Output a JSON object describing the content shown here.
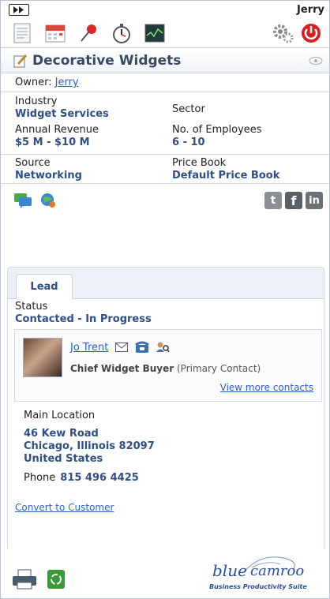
{
  "topbar": {
    "user": "Jerry"
  },
  "toolbar": {
    "icons": [
      "notes-icon",
      "calendar-icon",
      "pin-icon",
      "stopwatch-icon",
      "dashboard-icon",
      "settings-icon",
      "power-icon"
    ]
  },
  "record": {
    "title": "Decorative Widgets",
    "owner_label": "Owner:",
    "owner": "Jerry"
  },
  "fields": {
    "industry_label": "Industry",
    "industry": "Widget Services",
    "sector_label": "Sector",
    "sector": "",
    "revenue_label": "Annual Revenue",
    "revenue": "$5 M - $10 M",
    "employees_label": "No. of Employees",
    "employees": "6 - 10",
    "source_label": "Source",
    "source": "Networking",
    "pricebook_label": "Price Book",
    "pricebook": "Default Price Book"
  },
  "social": {
    "twitter": "t",
    "facebook": "f",
    "linkedin": "in"
  },
  "tab": {
    "label": "Lead",
    "status_label": "Status",
    "status": "Contacted - In Progress"
  },
  "contact": {
    "name": "Jo Trent",
    "title": "Chief Widget Buyer",
    "role": "(Primary Contact)",
    "more_link": "View more contacts"
  },
  "location": {
    "label": "Main Location",
    "line1": "46 Kew Road",
    "line2": "Chicago, Illinois 82097",
    "line3": "United States",
    "phone_label": "Phone",
    "phone": "815 496 4425"
  },
  "actions": {
    "convert": "Convert to Customer"
  },
  "brand": {
    "name_a": "blue",
    "name_b": "camroo",
    "tagline": "Business Productivity Suite"
  },
  "colors": {
    "accent": "#2f4f86",
    "link": "#2a63c4",
    "power": "#d42020"
  }
}
